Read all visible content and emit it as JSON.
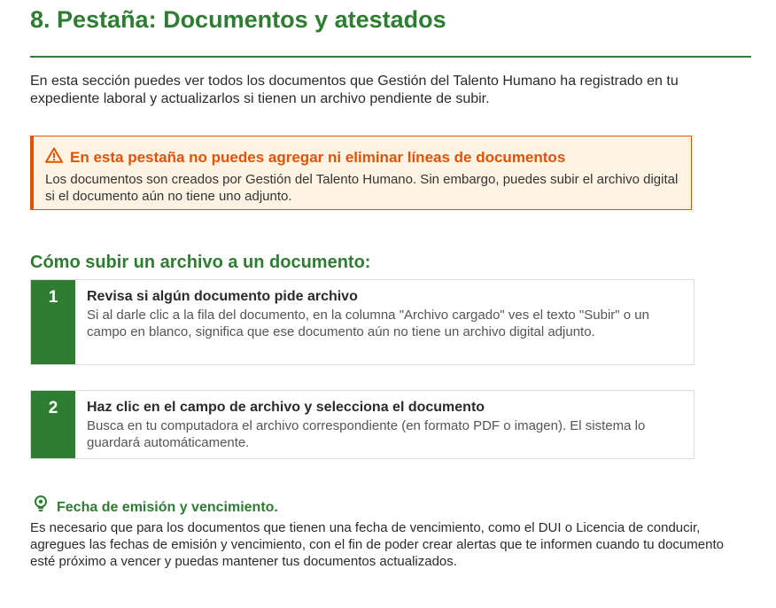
{
  "header": {
    "title": "8. Pestaña: Documentos y atestados"
  },
  "intro": {
    "text": "En esta sección puedes ver todos los documentos que Gestión del Talento Humano ha registrado en tu expediente laboral y actualizarlos si tienen un archivo pendiente de subir."
  },
  "warning": {
    "icon": "warning-triangle-icon",
    "title": "En esta pestaña no puedes agregar ni eliminar líneas de documentos",
    "body": "Los documentos son creados por Gestión del Talento Humano. Sin embargo, puedes subir el archivo digital si el documento aún no tiene uno adjunto."
  },
  "howto": {
    "title": "Cómo subir un archivo a un documento:",
    "steps": [
      {
        "number": "1",
        "title": "Revisa si algún documento pide archivo",
        "description": "Si al darle clic a la fila del documento, en la columna \"Archivo cargado\" ves el texto \"Subir\" o un campo en blanco, significa que ese documento aún no tiene un archivo digital adjunto."
      },
      {
        "number": "2",
        "title": "Haz clic en el campo de archivo y selecciona el documento",
        "description": "Busca en tu computadora el archivo correspondiente (en formato PDF o imagen). El sistema lo guardará automáticamente."
      }
    ]
  },
  "tip": {
    "icon": "lightbulb-icon",
    "title": "Fecha de emisión y vencimiento.",
    "body": "Es necesario que para los documentos que tienen una fecha de vencimiento, como el DUI o Licencia de conducir, agregues las fechas de emisión y vencimiento, con el fin de poder crear alertas que te informen cuando tu documento esté próximo a vencer y puedas mantener tus documentos actualizados."
  },
  "colors": {
    "primary_green": "#2e7d32",
    "warning_orange": "#e65100",
    "warning_background": "#fff4e3"
  }
}
